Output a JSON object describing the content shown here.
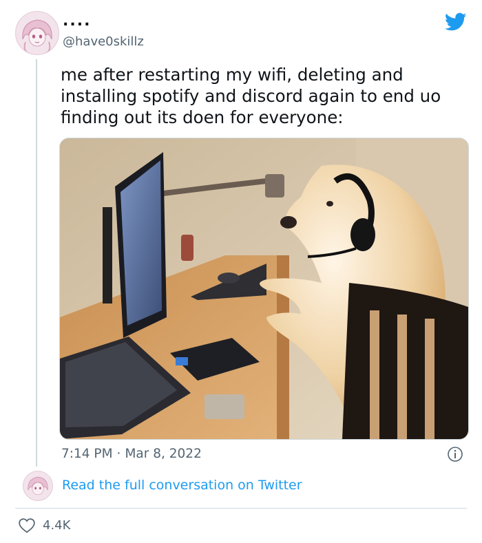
{
  "author": {
    "display_name": "....",
    "handle": "@have0skillz",
    "avatar": "anime-girl-avatar"
  },
  "tweet": {
    "text": "me after restarting my wifi, deleting and\ninstalling spotify and discord again to end uo\nfinding out its doen for everyone:",
    "media": "dog-wearing-headset-at-computer-desk-photo",
    "time": "7:14 PM",
    "date": "Mar 8, 2022"
  },
  "footer": {
    "read_full_conversation": "Read the full conversation on Twitter",
    "likes_count": "4.4K"
  },
  "icons": {
    "brand": "twitter-bird-icon",
    "info": "info-icon",
    "like": "heart-icon"
  },
  "colors": {
    "brand_blue": "#1d9bf0",
    "secondary_text": "#536471",
    "primary_text": "#0f1419",
    "divider": "#cfd9de"
  }
}
